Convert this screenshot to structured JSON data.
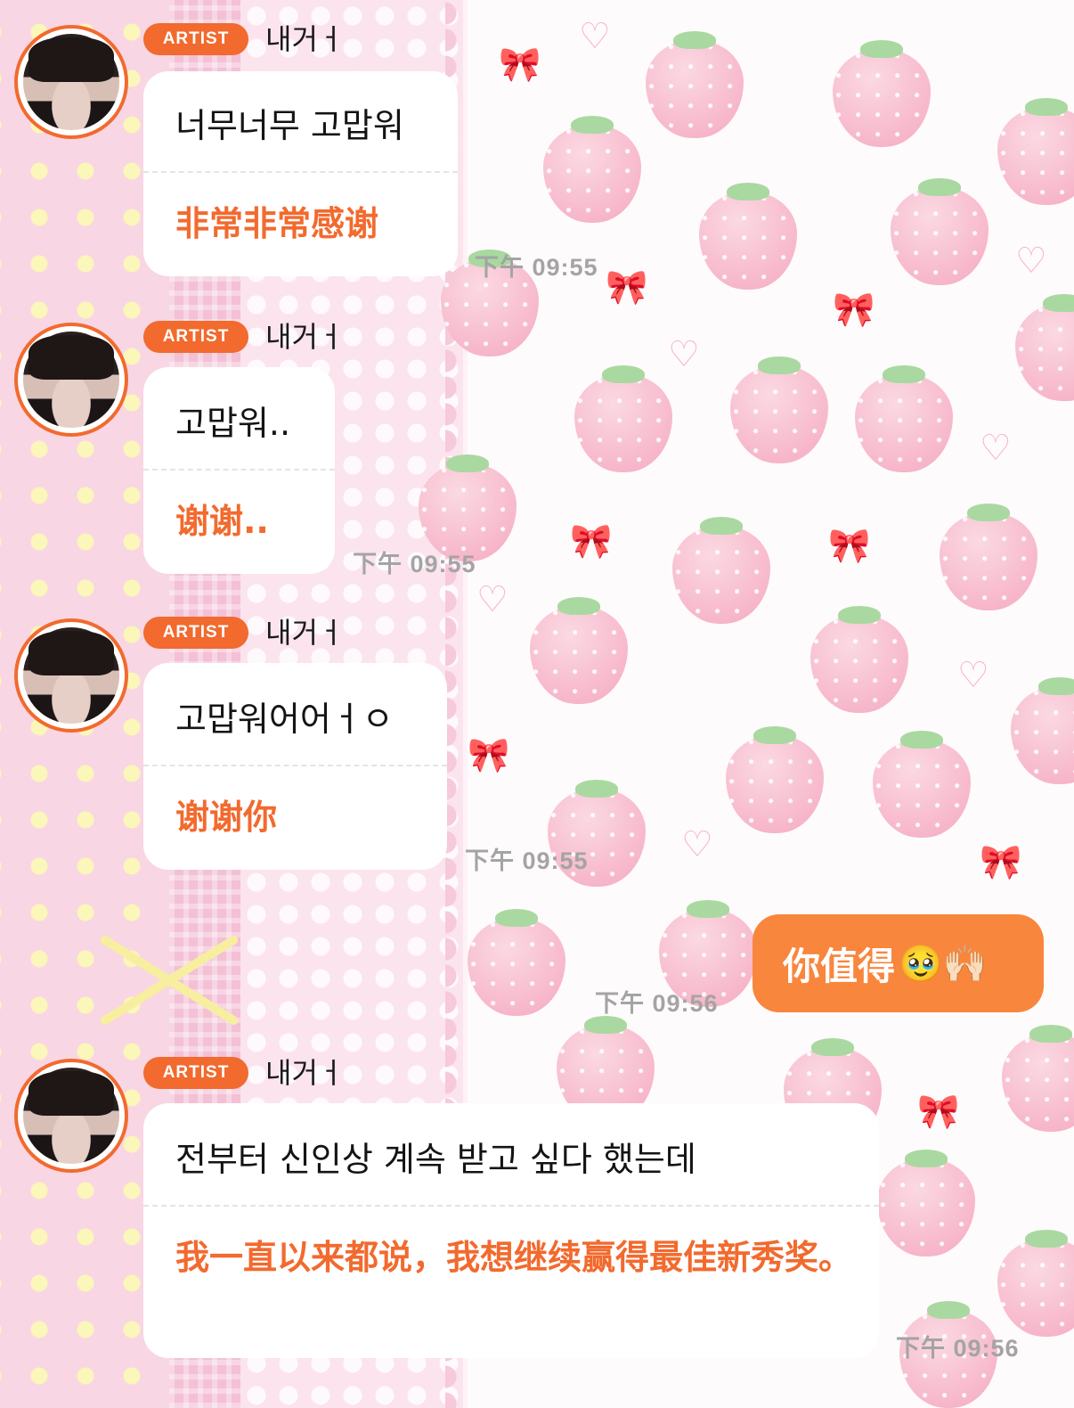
{
  "messages": [
    {
      "badge": "ARTIST",
      "name": "내거ㅓ",
      "korean": "너무너무 고맙워",
      "chinese": "非常非常感谢",
      "time": "下午 09:55"
    },
    {
      "badge": "ARTIST",
      "name": "내거ㅓ",
      "korean": "고맙워..",
      "chinese": "谢谢..",
      "time": "下午 09:55"
    },
    {
      "badge": "ARTIST",
      "name": "내거ㅓ",
      "korean": "고맙워어어ㅓㅇ",
      "chinese": "谢谢你",
      "time": "下午 09:55"
    },
    {
      "badge": "ARTIST",
      "name": "내거ㅓ",
      "korean": "전부터 신인상 계속 받고 싶다 했는데",
      "chinese": "我一直以来都说，我想继续赢得最佳新秀奖。",
      "time": "下午 09:56"
    }
  ],
  "my_message": {
    "text": "你值得",
    "emoji": "🥹🙌🏻",
    "time": "下午 09:56"
  },
  "colors": {
    "accent": "#f26a2e",
    "my_bubble": "#f8863d",
    "timestamp": "#a4a4a4"
  }
}
